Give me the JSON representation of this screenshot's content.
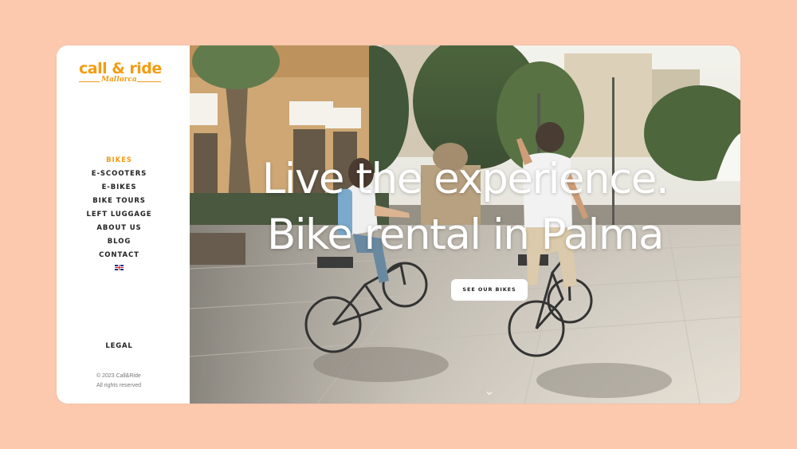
{
  "brand": {
    "logo_main": "call & ride",
    "logo_sub": "Mallorca",
    "color": "#f39c12"
  },
  "nav": {
    "items": [
      {
        "label": "BIKES",
        "active": true
      },
      {
        "label": "E-SCOOTERS",
        "active": false
      },
      {
        "label": "E-BIKES",
        "active": false
      },
      {
        "label": "BIKE TOURS",
        "active": false
      },
      {
        "label": "LEFT LUGGAGE",
        "active": false
      },
      {
        "label": "ABOUT US",
        "active": false
      },
      {
        "label": "BLOG",
        "active": false
      },
      {
        "label": "CONTACT",
        "active": false
      }
    ],
    "language_icon": "uk-flag-icon"
  },
  "footer": {
    "legal_label": "LEGAL",
    "copyright_line1": "© 2023 Call&Ride",
    "copyright_line2": "All rights reserved"
  },
  "hero": {
    "headline_line1": "Live the experience.",
    "headline_line2": "Bike rental in Palma",
    "cta_label": "SEE OUR BIKES",
    "scroll_icon": "chevron-down-icon"
  },
  "colors": {
    "page_background": "#fcc8ae",
    "accent": "#f39c12",
    "text_dark": "#222222"
  }
}
